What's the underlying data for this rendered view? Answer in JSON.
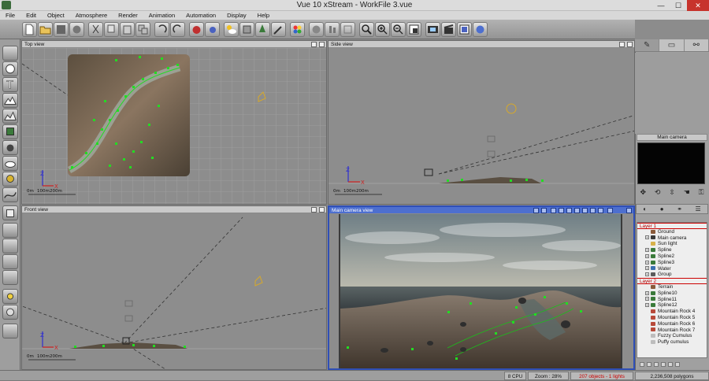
{
  "window": {
    "title": "Vue 10 xStream - WorkFile 3.vue",
    "minimize": "—",
    "maximize": "☐",
    "close": "✕"
  },
  "menu": [
    "File",
    "Edit",
    "Object",
    "Atmosphere",
    "Render",
    "Animation",
    "Automation",
    "Display",
    "Help"
  ],
  "viewports": {
    "top": {
      "title": "Top view",
      "scale_labels": [
        "0m",
        "100m",
        "200m"
      ],
      "axis_z": "Z",
      "axis_x": "X"
    },
    "side": {
      "title": "Side view",
      "scale_labels": [
        "0m",
        "100m",
        "200m"
      ],
      "axis_z": "Z",
      "axis_x": "X"
    },
    "front": {
      "title": "Front view",
      "scale_labels": [
        "0m",
        "100m",
        "200m"
      ],
      "axis_z": "Z",
      "axis_x": "X"
    },
    "camera": {
      "title": "Main camera view"
    }
  },
  "right_panel": {
    "camera_header": "Main camera",
    "tree": [
      {
        "label": "Layer 1",
        "kind": "layer"
      },
      {
        "label": "Ground",
        "kind": "item",
        "color": "#8a5a3a"
      },
      {
        "label": "Main camera",
        "kind": "item",
        "color": "#3a3a3a",
        "expand": true
      },
      {
        "label": "Sun light",
        "kind": "item",
        "color": "#d7b14a"
      },
      {
        "label": "Spline",
        "kind": "item",
        "color": "#3a7a3a",
        "expand": true
      },
      {
        "label": "Spline2",
        "kind": "item",
        "color": "#3a7a3a",
        "expand": true
      },
      {
        "label": "Spline3",
        "kind": "item",
        "color": "#3a7a3a",
        "expand": true
      },
      {
        "label": "Water",
        "kind": "item",
        "color": "#3a6fb0",
        "expand": true
      },
      {
        "label": "Group",
        "kind": "item",
        "color": "#5a5a5a",
        "expand": true
      },
      {
        "label": "Layer 2",
        "kind": "layer"
      },
      {
        "label": "Terrain",
        "kind": "item",
        "color": "#8a5a3a"
      },
      {
        "label": "Spline10",
        "kind": "item",
        "color": "#3a7a3a",
        "expand": true
      },
      {
        "label": "Spline11",
        "kind": "item",
        "color": "#3a7a3a",
        "expand": true
      },
      {
        "label": "Spline12",
        "kind": "item",
        "color": "#3a7a3a",
        "expand": true
      },
      {
        "label": "Mountain Rock 4",
        "kind": "item",
        "color": "#b84a3a"
      },
      {
        "label": "Mountain Rock 5",
        "kind": "item",
        "color": "#b84a3a"
      },
      {
        "label": "Mountain Rock 6",
        "kind": "item",
        "color": "#b84a3a"
      },
      {
        "label": "Mountain Rock 7",
        "kind": "item",
        "color": "#b84a3a"
      },
      {
        "label": "Fuzzy Cumulus",
        "kind": "item",
        "color": "#bdbdbd"
      },
      {
        "label": "Puffy cumulus",
        "kind": "item",
        "color": "#bdbdbd"
      }
    ]
  },
  "status": {
    "cpu": "8 CPU",
    "zoom": "Zoom : 28%",
    "objects": "207 objects - 1 lights",
    "polygons": "2,236,508 polygons"
  },
  "colors": {
    "accent_active_viewport": "#4d6fcf",
    "selection_green": "#22dd22",
    "layer_red": "#b40000",
    "close_button": "#c7332c"
  }
}
